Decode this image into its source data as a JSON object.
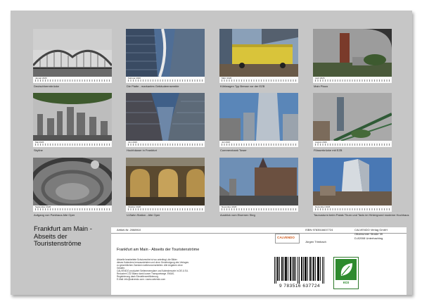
{
  "months": [
    {
      "caption": "Deutschherrnbrücke",
      "month": "Januar 2026"
    },
    {
      "caption": "Die Platte - markantes Gebäudeensemble",
      "month": "Februar 2026"
    },
    {
      "caption": "Kühlwagen Typ Bresse vor der EZB",
      "month": "März 2026"
    },
    {
      "caption": "Main Plaza",
      "month": "April 2026"
    },
    {
      "caption": "Skyline",
      "month": "Mai 2026"
    },
    {
      "caption": "Hochhäuser in Frankfurt",
      "month": "Juni 2026"
    },
    {
      "caption": "Commerzbank Tower",
      "month": "Juli 2026"
    },
    {
      "caption": "Flösserbrücke mit EZB",
      "month": "August 2026"
    },
    {
      "caption": "Aufgang von Parkhaus Alte Oper",
      "month": "September 2026"
    },
    {
      "caption": "U-Bahn Station - Alte Oper",
      "month": "Oktober 2026"
    },
    {
      "caption": "Ausblick vom Eisernen Steg",
      "month": "November 2026"
    },
    {
      "caption": "Taunusturm beim Palais Thurn und Taxis im Hintergrund moderne Hochhaus",
      "month": "Dezember 2026"
    }
  ],
  "cover_title": "Frankfurt am Main - Abseits der Touristenströme",
  "card": {
    "article": "Artikel-Nr. 2088910",
    "isbn": "ISBN 9783516637724",
    "author": "Jürgen Trimbach",
    "publisher_name": "CALVENDO Verlag GmbH",
    "publisher_street": "Ottobrunner Straße 39",
    "publisher_city": "D-82008 Unterhaching",
    "product_title": "Frankfurt am Main - Abseits der Touristenströme",
    "logo_text": "CALVENDO",
    "description_lines": [
      "Aktuelle bearbeitete Schutzrechte ist wo unterliegt, die Bilder",
      "dieses Kalenders herauszuleisten und ohne Genehmigung des Verlages",
      "zu gewerblichen Zwecken weiterzuverarbeiten. Alle Angaben ohne",
      "Gewähr.",
      "CALVENDO produziert Seitenexemplare und Kalendersorte in DE & EU.",
      "Reduziert CO2 Bilanz dank kurzer Transportwege. EMAS-",
      "Registrierung dank Einstellerzertifizierung.",
      "E-Mail: info@calvendo.com • www.calvendo.com"
    ],
    "barcode_digits": "9 783516 637724",
    "eco_label": "eco"
  }
}
